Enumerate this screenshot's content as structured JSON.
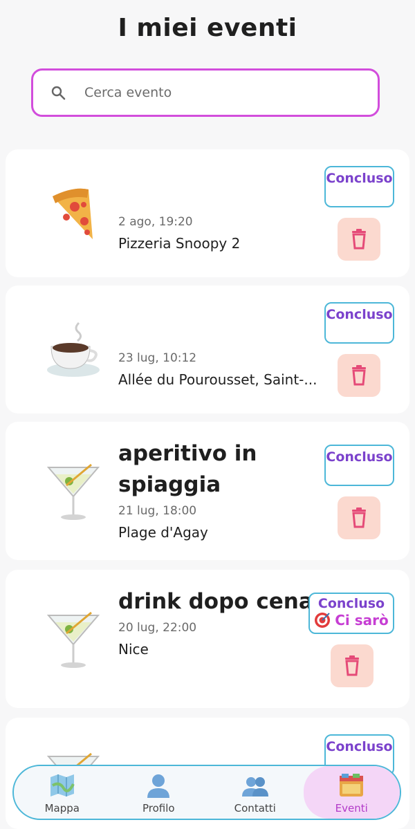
{
  "header": {
    "title": "I miei eventi"
  },
  "search": {
    "placeholder": "Cerca evento",
    "value": ""
  },
  "events": [
    {
      "emoji": "pizza-icon",
      "title": "",
      "date": "2 ago, 19:20",
      "place": "Pizzeria Snoopy 2",
      "status": "Concluso"
    },
    {
      "emoji": "coffee-icon",
      "title": "",
      "date": "23 lug, 10:12",
      "place": "Allée du Pourousset, Saint-...",
      "status": "Concluso"
    },
    {
      "emoji": "cocktail-icon",
      "title": "aperitivo in spiaggia",
      "date": "21 lug, 18:00",
      "place": "Plage d'Agay",
      "status": "Concluso"
    },
    {
      "emoji": "cocktail-icon",
      "title": "drink dopo cena",
      "date": "20 lug, 22:00",
      "place": "Nice",
      "status": "Concluso",
      "rsvp": "Ci sarò"
    },
    {
      "emoji": "cocktail-icon",
      "title": "",
      "date": "",
      "place": "",
      "status": "Concluso"
    }
  ],
  "nav": {
    "items": [
      {
        "label": "Mappa",
        "icon": "map-icon"
      },
      {
        "label": "Profilo",
        "icon": "profile-icon"
      },
      {
        "label": "Contatti",
        "icon": "contacts-icon"
      },
      {
        "label": "Eventi",
        "icon": "events-icon",
        "active": true
      }
    ]
  },
  "colors": {
    "accent": "#d24ddc",
    "status_border": "#4cb7d8",
    "status_text": "#7b42cc",
    "trash_bg": "#fbd9cf",
    "trash_icon": "#e54b78"
  }
}
